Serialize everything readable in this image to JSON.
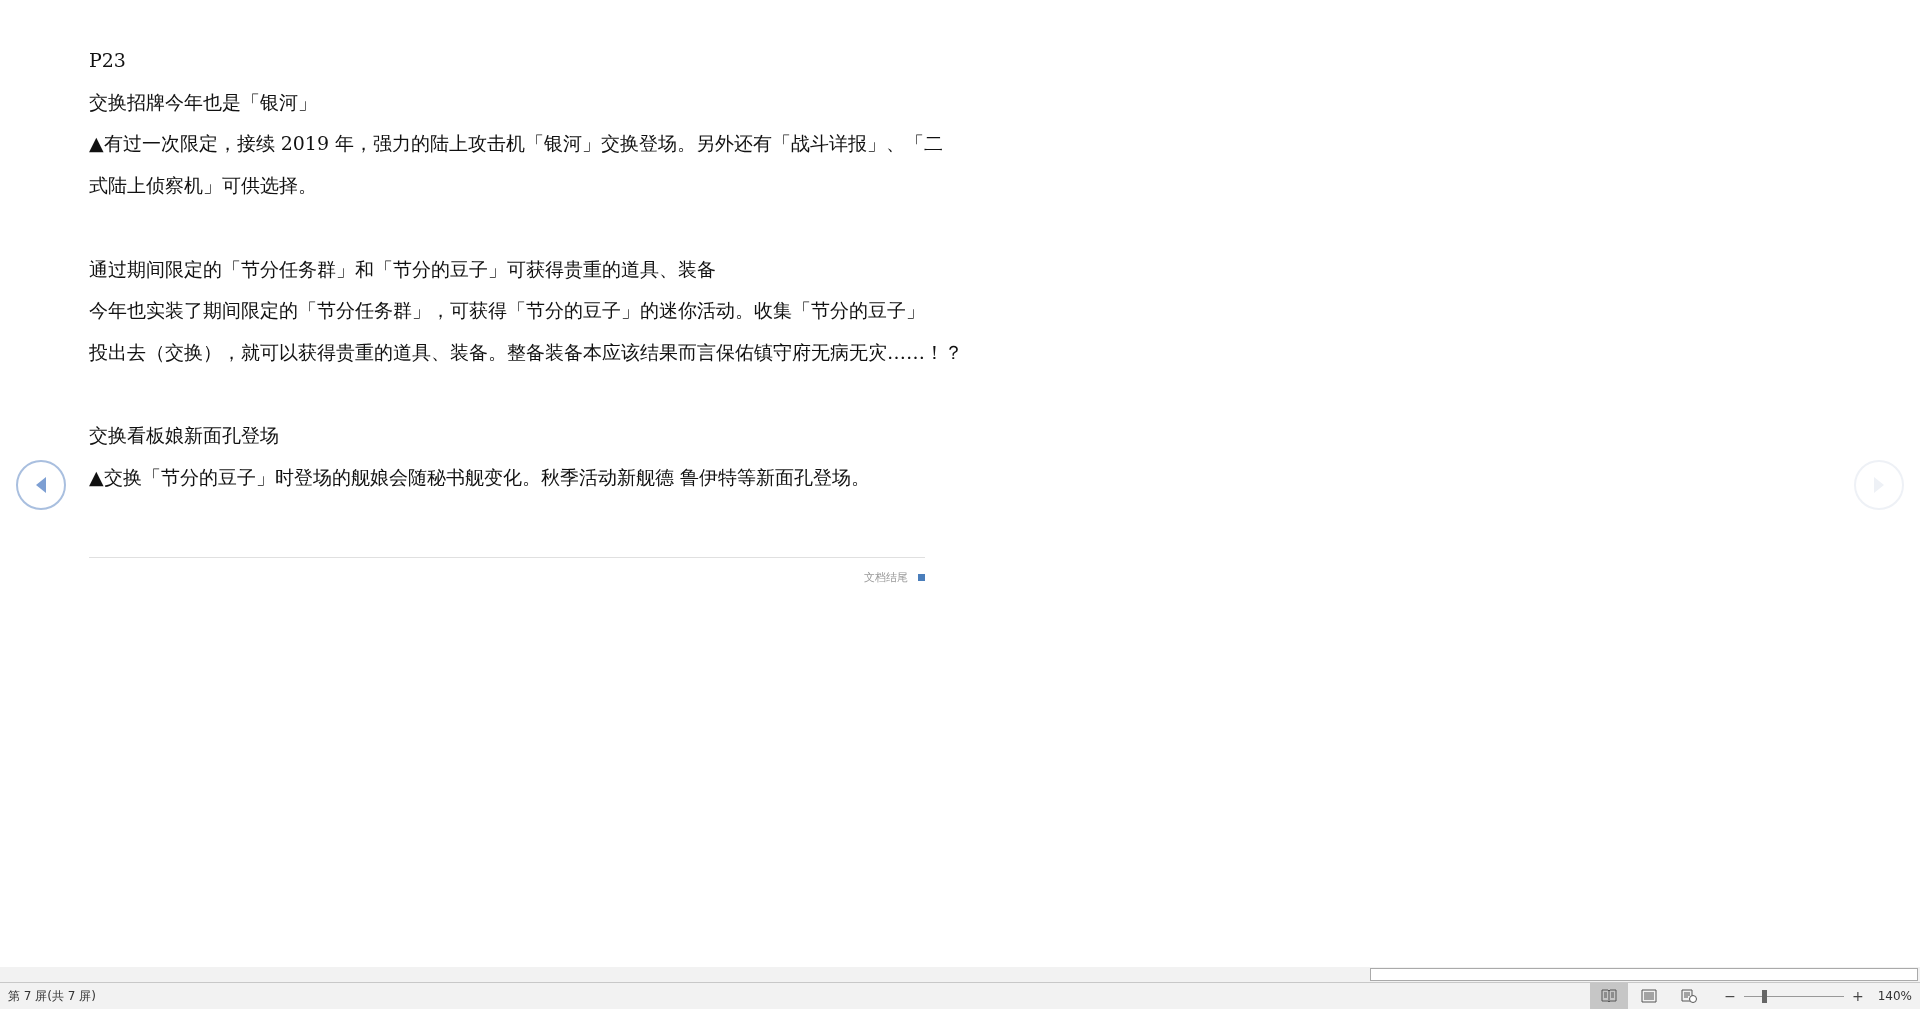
{
  "document": {
    "paragraphs": [
      {
        "lines": [
          "P23"
        ]
      },
      {
        "lines": [
          "交换招牌今年也是「银河」"
        ]
      },
      {
        "lines": [
          "▲有过一次限定，接续 2019 年，强力的陆上攻击机「银河」交换登场。另外还有「战斗详报」、「二",
          "式陆上侦察机」可供选择。"
        ]
      },
      {
        "kind": "blank"
      },
      {
        "lines": [
          "通过期间限定的「节分任务群」和「节分的豆子」可获得贵重的道具、装备"
        ]
      },
      {
        "lines": [
          "今年也实装了期间限定的「节分任务群」，可获得「节分的豆子」的迷你活动。收集「节分的豆子」",
          "投出去（交换），就可以获得贵重的道具、装备。整备装备本应该结果而言保佑镇守府无病无灾……！？"
        ]
      },
      {
        "kind": "blank"
      },
      {
        "lines": [
          "交换看板娘新面孔登场"
        ]
      },
      {
        "lines": [
          "▲交换「节分的豆子」时登场的舰娘会随秘书舰变化。秋季活动新舰德 鲁伊特等新面孔登场。"
        ]
      }
    ],
    "end_label": "文档结尾"
  },
  "nav": {
    "previous": {
      "disabled": false
    },
    "next": {
      "disabled": true
    }
  },
  "status_bar": {
    "page_info": "第 7 屏(共 7 屏)",
    "views": [
      {
        "kind": "read",
        "selected": true
      },
      {
        "kind": "print",
        "selected": false
      },
      {
        "kind": "web",
        "selected": false
      }
    ],
    "zoom_out": "−",
    "zoom_in": "+",
    "zoom": {
      "level": 0.2
    },
    "zoom_label": "140%"
  }
}
